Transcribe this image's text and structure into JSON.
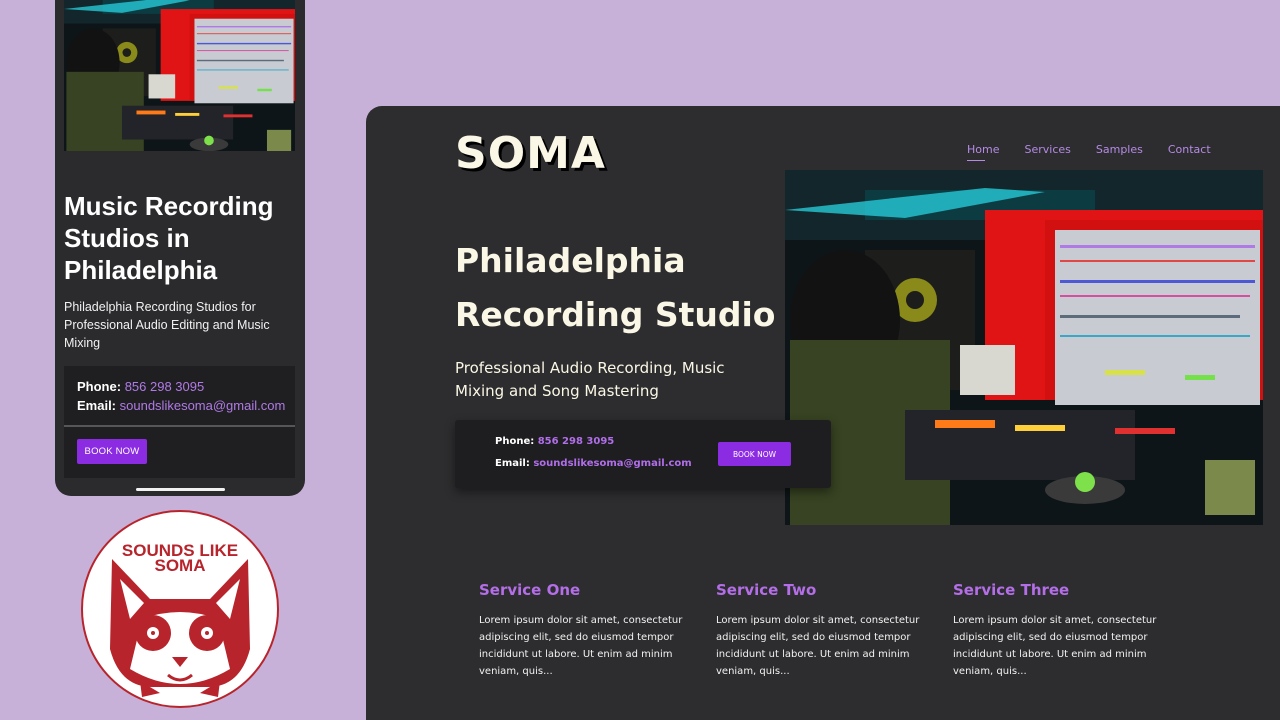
{
  "mobile": {
    "title": "Music Recording Studios in Philadelphia",
    "subtitle": "Philadelphia Recording Studios for Professional Audio Editing and Music Mixing",
    "phone_label": "Phone:",
    "phone_value": "856 298 3095",
    "email_label": "Email:",
    "email_value": "soundslikesoma@gmail.com",
    "book_label": "BOOK NOW"
  },
  "badge": {
    "text_line1": "SOUNDS LIKE",
    "text_line2": "SOMA"
  },
  "desktop": {
    "logo": "SOMA",
    "nav": [
      "Home",
      "Services",
      "Samples",
      "Contact"
    ],
    "title_line1": "Philadelphia",
    "title_line2": "Recording Studio",
    "subtitle": "Professional Audio Recording, Music Mixing and Song Mastering",
    "phone_label": "Phone:",
    "phone_value": "856 298 3095",
    "email_label": "Email:",
    "email_value": "soundslikesoma@gmail.com",
    "book_label": "BOOK NOW",
    "services": [
      {
        "title": "Service One",
        "text": "Lorem ipsum dolor sit amet, consectetur adipiscing elit, sed do eiusmod tempor incididunt ut labore. Ut enim ad minim veniam, quis..."
      },
      {
        "title": "Service Two",
        "text": "Lorem ipsum dolor sit amet, consectetur adipiscing elit, sed do eiusmod tempor incididunt ut labore. Ut enim ad minim veniam, quis..."
      },
      {
        "title": "Service Three",
        "text": "Lorem ipsum dolor sit amet, consectetur adipiscing elit, sed do eiusmod tempor incididunt ut labore. Ut enim ad minim veniam, quis..."
      }
    ]
  },
  "colors": {
    "background": "#c7b1d8",
    "panel": "#2d2d2f",
    "accent": "#8b2be2",
    "accent_text": "#b46ee8",
    "badge_red": "#b8242c"
  }
}
